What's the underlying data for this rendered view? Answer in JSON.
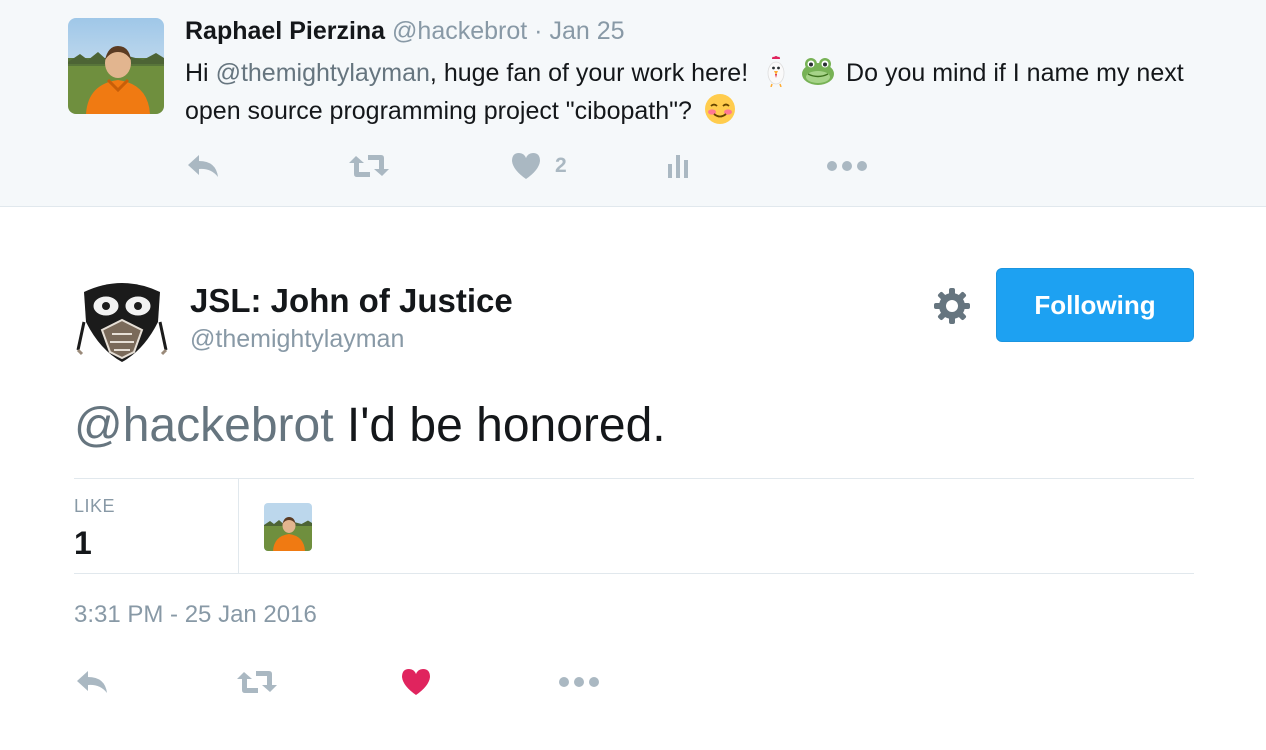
{
  "parent_tweet": {
    "author_name": "Raphael Pierzina",
    "author_handle": "@hackebrot",
    "separator": "·",
    "date": "Jan 25",
    "text_before_mention": "Hi ",
    "mention": "@themightylayman",
    "text_after_mention": ", huge fan of your work here! ",
    "text_middle": " Do you mind if I name my next open source programming project \"cibopath\"? ",
    "emojis": [
      "chicken-emoji",
      "frog-emoji",
      "smiling-blush-emoji"
    ],
    "actions": {
      "reply_icon": "reply-icon",
      "retweet_icon": "retweet-icon",
      "like_icon": "heart-icon",
      "like_count": "2",
      "analytics_icon": "analytics-icon",
      "more_icon": "more-icon"
    }
  },
  "main_tweet": {
    "author_name": "JSL: John of Justice",
    "author_handle": "@themightylayman",
    "settings_icon": "gear-icon",
    "follow_button_label": "Following",
    "mention": "@hackebrot",
    "text": " I'd be honored.",
    "stats": {
      "like_label": "LIKE",
      "like_count": "1"
    },
    "timestamp": "3:31 PM - 25 Jan 2016",
    "actions": {
      "reply_icon": "reply-icon",
      "retweet_icon": "retweet-icon",
      "like_icon": "heart-icon",
      "like_state": "liked",
      "more_icon": "more-icon"
    }
  },
  "colors": {
    "accent_blue": "#1da1f2",
    "liked_red": "#e0245e",
    "muted_gray": "#8899a6",
    "icon_gray": "#aab8c2",
    "parent_background": "#f5f8fa"
  }
}
